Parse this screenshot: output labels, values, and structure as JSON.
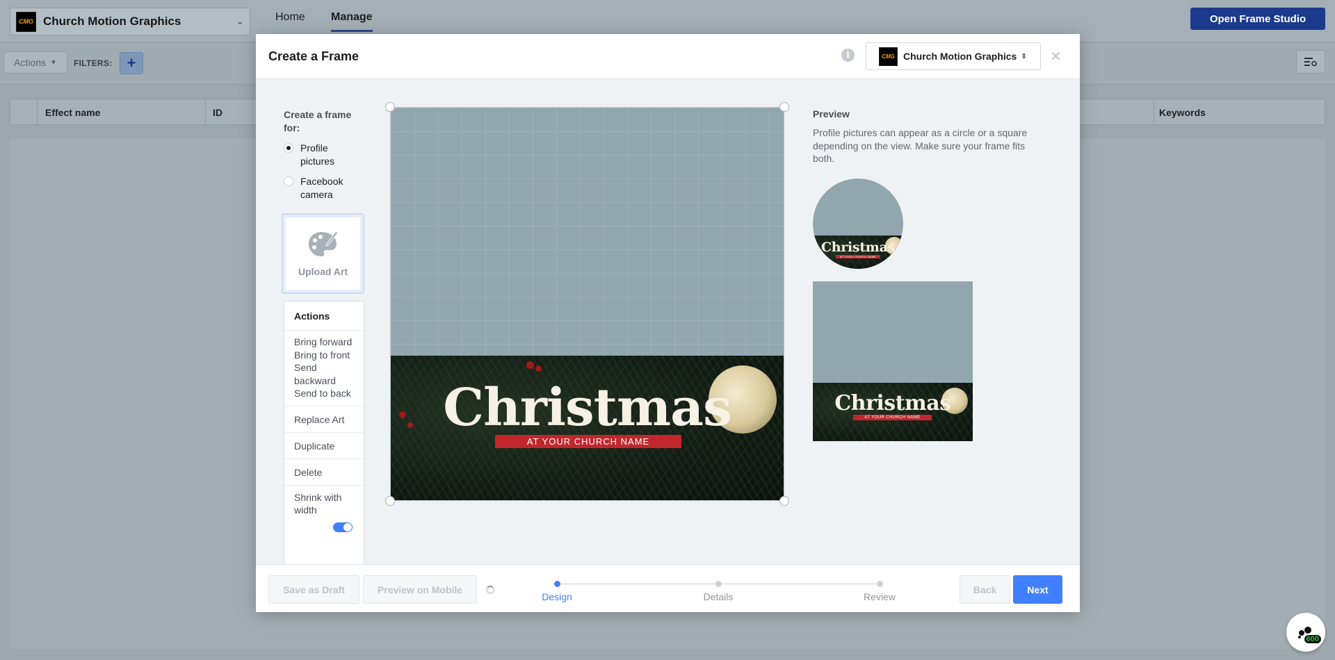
{
  "app": {
    "page_selector": {
      "logo_text": "CMG",
      "name": "Church Motion Graphics"
    },
    "nav": {
      "home": "Home",
      "manage": "Manage"
    },
    "open_studio_button": "Open Frame Studio",
    "toolbar": {
      "actions_label": "Actions",
      "filters_label": "FILTERS:",
      "add_label": "+"
    },
    "table": {
      "columns": [
        "Effect name",
        "ID",
        "Keywords"
      ]
    },
    "chat": {
      "badge": "600"
    }
  },
  "modal": {
    "title": "Create a Frame",
    "page_picker": {
      "logo_text": "CMG",
      "name": "Church Motion Graphics"
    },
    "left": {
      "create_for_label": "Create a frame for:",
      "options": [
        {
          "label": "Profile pictures",
          "selected": true
        },
        {
          "label": "Facebook camera",
          "selected": false
        }
      ],
      "upload_art": "Upload Art",
      "actions_panel": {
        "title": "Actions",
        "order_items": [
          "Bring forward",
          "Bring to front",
          "Send backward",
          "Send to back"
        ],
        "replace_art": "Replace Art",
        "duplicate": "Duplicate",
        "delete": "Delete",
        "shrink_with_width": "Shrink with width",
        "shrink_toggle_on": true
      }
    },
    "artwork": {
      "title": "Christmas",
      "subtitle": "AT YOUR CHURCH NAME"
    },
    "preview": {
      "title": "Preview",
      "description": "Profile pictures can appear as a circle or a square depending on the view. Make sure your frame fits both."
    },
    "footer": {
      "save_draft": "Save as Draft",
      "preview_mobile": "Preview on Mobile",
      "steps": [
        {
          "label": "Design",
          "active": true
        },
        {
          "label": "Details",
          "active": false
        },
        {
          "label": "Review",
          "active": false
        }
      ],
      "back": "Back",
      "next": "Next"
    }
  },
  "colors": {
    "primary": "#4080ff",
    "studio_button": "#1b3a8c",
    "ribbon": "#c1272d"
  }
}
